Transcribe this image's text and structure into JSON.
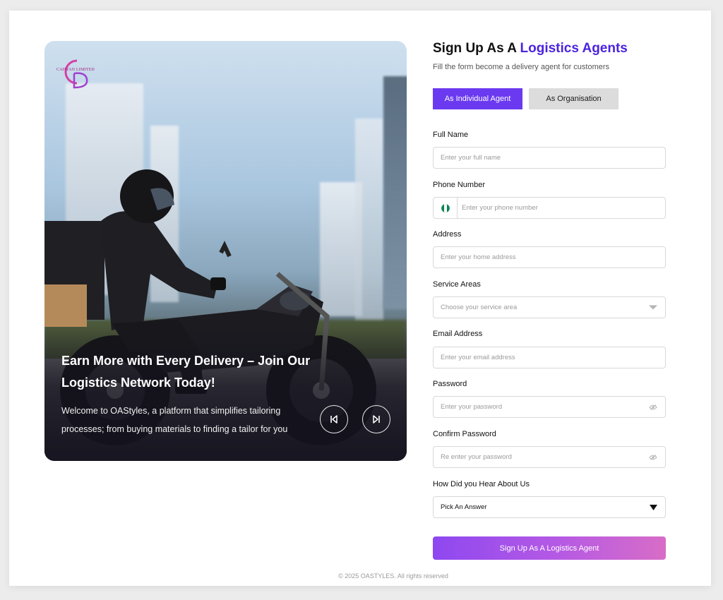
{
  "brand": {
    "logo_text": "CAHYAN LIMITED"
  },
  "hero": {
    "title": "Earn More with Every Delivery – Join Our Logistics Network Today!",
    "description": "Welcome to OAStyles, a platform that simplifies tailoring processes; from buying materials to finding a tailor for you",
    "prev_icon": "skip-previous-icon",
    "next_icon": "skip-next-icon"
  },
  "form": {
    "title_prefix": "Sign Up As A ",
    "title_accent": "Logistics Agents",
    "subtitle": "Fill the form become a delivery agent for customers",
    "tabs": [
      {
        "label": "As Individual Agent",
        "active": true
      },
      {
        "label": "As Organisation",
        "active": false
      }
    ],
    "fields": {
      "full_name": {
        "label": "Full Name",
        "placeholder": "Enter your full name"
      },
      "phone": {
        "label": "Phone Number",
        "placeholder": "Enter your phone number",
        "flag": "nigeria-flag-icon"
      },
      "address": {
        "label": "Address",
        "placeholder": "Enter your home address"
      },
      "service_areas": {
        "label": "Service Areas",
        "placeholder": "Choose your service area"
      },
      "email": {
        "label": "Email Address",
        "placeholder": "Enter your email address"
      },
      "password": {
        "label": "Password",
        "placeholder": "Enter your password"
      },
      "confirm_password": {
        "label": "Confirm Password",
        "placeholder": "Re enter your password"
      },
      "referral": {
        "label": "How Did you Hear About Us",
        "value": "Pick An Answer"
      }
    },
    "submit_label": "Sign Up As A Logistics Agent"
  },
  "footer": {
    "text": "© 2025 OASTYLES. All rights reserved"
  },
  "colors": {
    "accent": "#4b23e0",
    "tab_active": "#6b3af0",
    "submit_start": "#8e48f0",
    "submit_end": "#d86dc7"
  }
}
